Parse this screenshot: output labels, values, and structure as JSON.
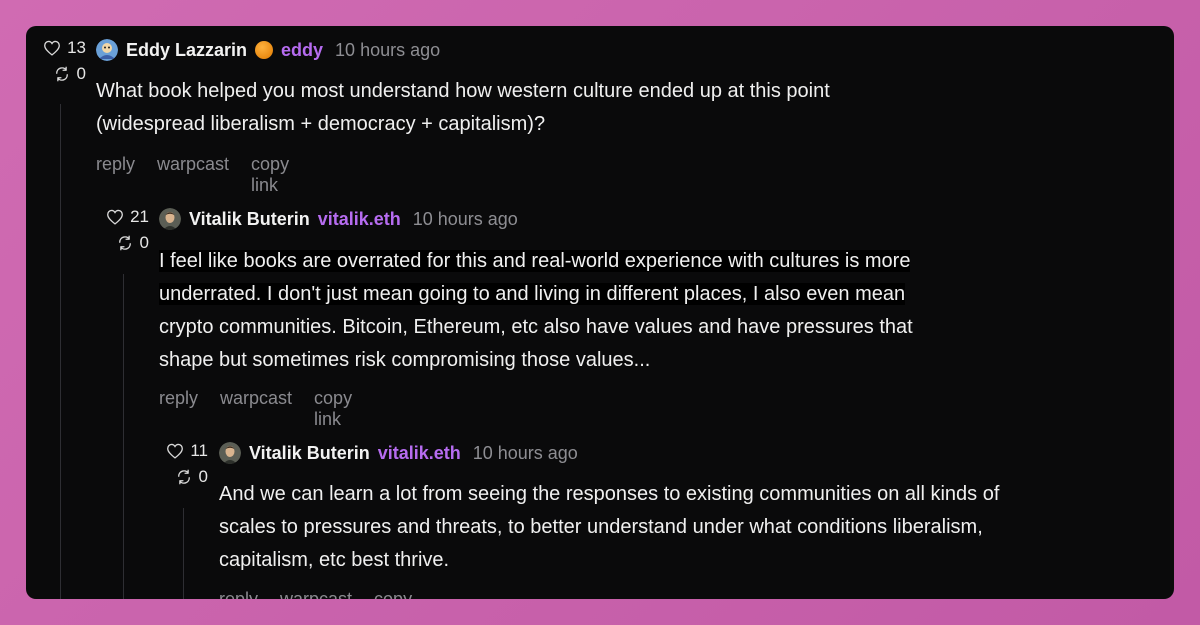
{
  "comments": [
    {
      "likes": "13",
      "recasts": "0",
      "author": "Eddy Lazzarin",
      "handle": "eddy",
      "time": "10 hours ago",
      "text_lines": [
        "What book helped you most understand how western culture ended up at this point",
        "(widespread liberalism + democracy + capitalism)?"
      ],
      "actions": [
        "reply",
        "warpcast",
        "copy link"
      ]
    },
    {
      "likes": "21",
      "recasts": "0",
      "author": "Vitalik Buterin",
      "handle": "vitalik.eth",
      "time": "10 hours ago",
      "text_lines": [
        "I feel like books are overrated for this and real-world experience with cultures is more",
        "underrated. I don't just mean going to and living in different places, I also even mean",
        "crypto communities. Bitcoin, Ethereum, etc also have values and have pressures that",
        "shape but sometimes risk compromising those values..."
      ],
      "actions": [
        "reply",
        "warpcast",
        "copy link"
      ]
    },
    {
      "likes": "11",
      "recasts": "0",
      "author": "Vitalik Buterin",
      "handle": "vitalik.eth",
      "time": "10 hours ago",
      "text_lines": [
        "And we can learn a lot from seeing the responses to existing communities on all kinds of",
        "scales to pressures and threats, to better understand under what conditions liberalism,",
        "capitalism, etc best thrive."
      ],
      "actions": [
        "reply",
        "warpcast",
        "copy link"
      ]
    }
  ],
  "colors": {
    "handle": "#b66cf0",
    "muted": "#8a8a8f",
    "card": "#0a0a0b",
    "background": "#c862ad"
  },
  "icons": {
    "like": "heart-icon",
    "recast": "recast-icon",
    "power_badge": "orange-dot-badge"
  }
}
